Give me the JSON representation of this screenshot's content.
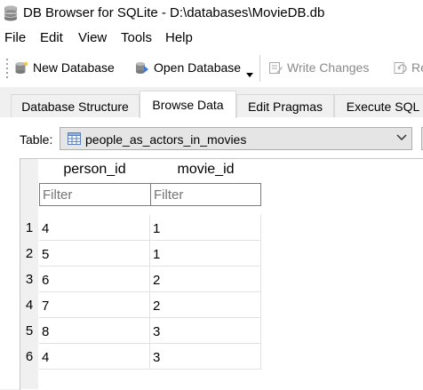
{
  "window": {
    "title": "DB Browser for SQLite - D:\\databases\\MovieDB.db"
  },
  "menu": [
    "File",
    "Edit",
    "View",
    "Tools",
    "Help"
  ],
  "toolbar": {
    "new_database": "New Database",
    "open_database": "Open Database",
    "write_changes": "Write Changes",
    "revert_partial": "Re"
  },
  "tabs": [
    "Database Structure",
    "Browse Data",
    "Edit Pragmas",
    "Execute SQL"
  ],
  "active_tab": "Browse Data",
  "table_selector": {
    "label": "Table:",
    "value": "people_as_actors_in_movies"
  },
  "grid": {
    "columns": [
      "person_id",
      "movie_id"
    ],
    "filter_placeholder": "Filter",
    "rows": [
      {
        "num": "1",
        "cells": [
          "4",
          "1"
        ]
      },
      {
        "num": "2",
        "cells": [
          "5",
          "1"
        ]
      },
      {
        "num": "3",
        "cells": [
          "6",
          "2"
        ]
      },
      {
        "num": "4",
        "cells": [
          "7",
          "2"
        ]
      },
      {
        "num": "5",
        "cells": [
          "8",
          "3"
        ]
      },
      {
        "num": "6",
        "cells": [
          "4",
          "3"
        ]
      }
    ]
  },
  "icons": {
    "app": "database-cylinder-icon",
    "new_database": "new-database-icon",
    "open_database": "open-database-icon",
    "write_changes": "write-changes-icon",
    "revert": "revert-icon",
    "table": "table-icon",
    "dropdown": "chevron-down-icon"
  }
}
